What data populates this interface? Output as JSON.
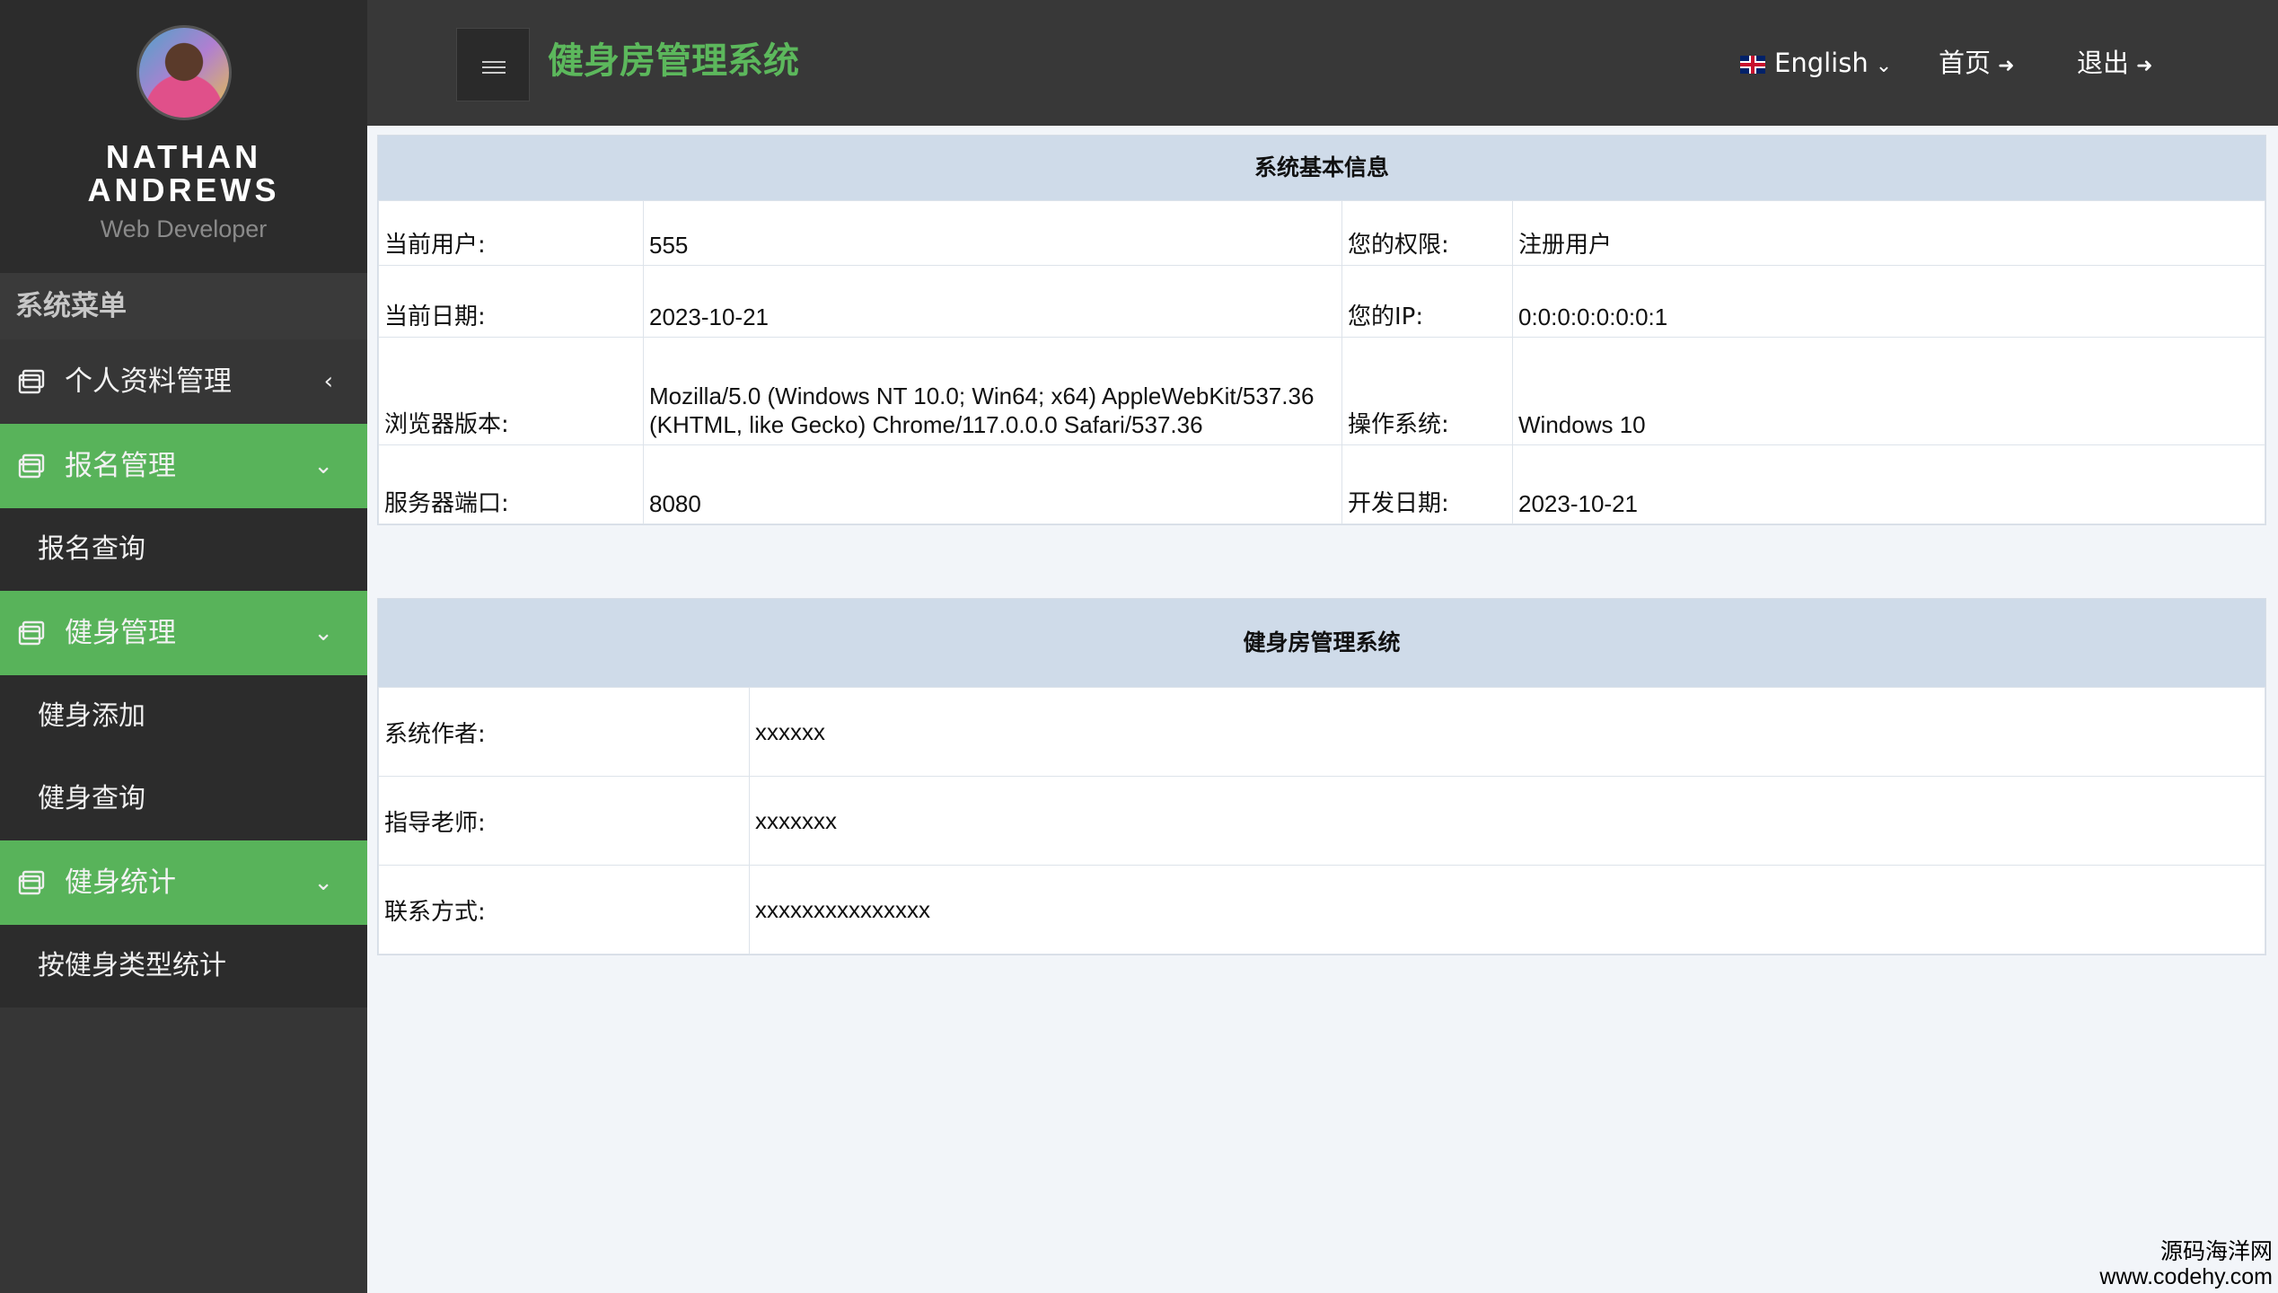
{
  "profile": {
    "name_line1": "NATHAN",
    "name_line2": "ANDREWS",
    "role": "Web Developer"
  },
  "sidebar": {
    "heading": "系统菜单",
    "items": [
      {
        "label": "个人资料管理",
        "icon": "window-icon",
        "chevron": "‹",
        "expanded": false
      },
      {
        "label": "报名管理",
        "icon": "window-icon",
        "chevron": "⌄",
        "expanded": true,
        "children": [
          "报名查询"
        ]
      },
      {
        "label": "健身管理",
        "icon": "window-icon",
        "chevron": "⌄",
        "expanded": true,
        "children": [
          "健身添加",
          "健身查询"
        ]
      },
      {
        "label": "健身统计",
        "icon": "window-icon",
        "chevron": "⌄",
        "expanded": true,
        "children": [
          "按健身类型统计"
        ]
      }
    ]
  },
  "header": {
    "title": "健身房管理系统",
    "language": "English",
    "home": "首页",
    "logout": "退出"
  },
  "system_info": {
    "title": "系统基本信息",
    "rows": [
      {
        "k1": "当前用户:",
        "v1": "555",
        "k2": "您的权限:",
        "v2": "注册用户"
      },
      {
        "k1": "当前日期:",
        "v1": "2023-10-21",
        "k2": "您的IP:",
        "v2": "0:0:0:0:0:0:0:1"
      },
      {
        "k1": "浏览器版本:",
        "v1a": "Mozilla/5.0 (Windows NT 10.0; Win64; x64) AppleWebKit/537.36",
        "v1b": "(KHTML, like Gecko) Chrome/117.0.0.0 Safari/537.36",
        "k2": "操作系统:",
        "v2": "Windows 10"
      },
      {
        "k1": "服务器端口:",
        "v1": "8080",
        "k2": "开发日期:",
        "v2": "2023-10-21"
      }
    ]
  },
  "about": {
    "title": "健身房管理系统",
    "rows": [
      {
        "k": "系统作者:",
        "v": "xxxxxx"
      },
      {
        "k": "指导老师:",
        "v": "xxxxxxx"
      },
      {
        "k": "联系方式:",
        "v": "xxxxxxxxxxxxxxx"
      }
    ]
  },
  "watermark": {
    "line1": "源码海洋网",
    "line2": "www.codehy.com"
  },
  "colors": {
    "accent": "#5cb85c",
    "sidebar_bg": "#363636",
    "header_bg": "#383838",
    "panel_head_bg": "#cfdbe9"
  }
}
